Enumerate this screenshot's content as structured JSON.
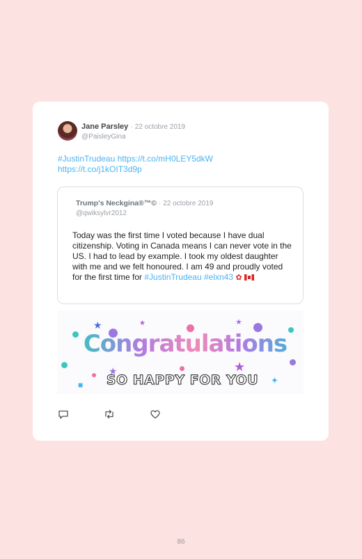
{
  "tweet": {
    "author_name": "Jane Parsley",
    "date_sep": "·",
    "date": "22 octobre 2019",
    "handle": "@PaisleyGina",
    "link1": "#JustinTrudeau https://t.co/mH0LEY5dkW",
    "link2": "https://t.co/j1kOIT3d9p"
  },
  "quote": {
    "author_name": "Trump's Neckgina®™©",
    "date_sep": "·",
    "date": "22 octobre 2019",
    "handle": "@qwiksylvr2012",
    "text": "Today was the first time I voted because I have dual citizenship. Voting in Canada means I can never vote in the US. I had to lead by example. I took my oldest daughter with me and we felt honoured. I am 49 and proudly voted for the first time for",
    "tags": "#JustinTrudeau #elxn43"
  },
  "gif": {
    "title": "Congratulations",
    "subtitle": "SO HAPPY FOR YOU"
  },
  "actions": {
    "reply_icon": "reply-icon",
    "retweet_icon": "retweet-icon",
    "like_icon": "heart-icon"
  },
  "page_number": "86"
}
